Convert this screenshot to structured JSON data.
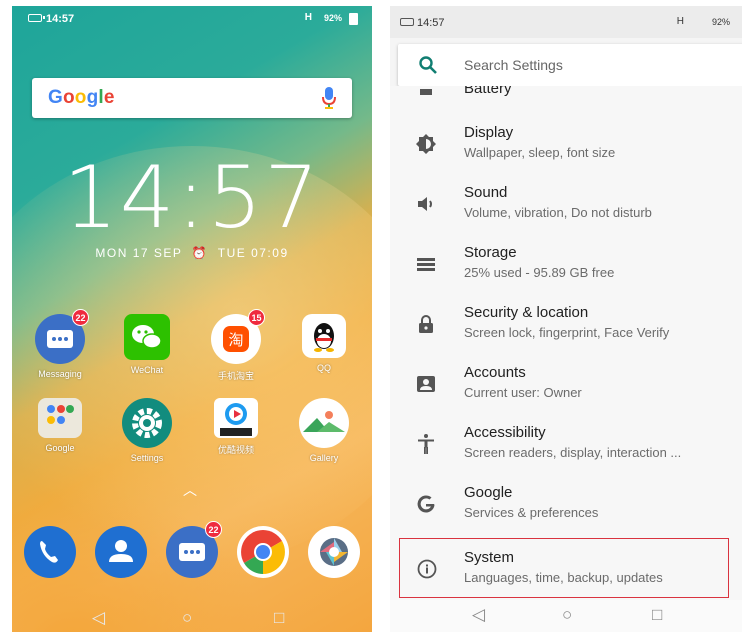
{
  "home": {
    "status": {
      "time": "14:57",
      "network": "H",
      "signal": "92%"
    },
    "search_logo": "Google",
    "clock": "14:57",
    "date_left": "MON 17 SEP",
    "alarm": "TUE 07:09",
    "apps_row1": [
      {
        "label": "Messaging",
        "icon": "message-icon",
        "badge": "22"
      },
      {
        "label": "WeChat",
        "icon": "wechat-icon",
        "badge": ""
      },
      {
        "label": "手机淘宝",
        "icon": "taobao-icon",
        "badge": "15"
      },
      {
        "label": "QQ",
        "icon": "qq-icon",
        "badge": ""
      }
    ],
    "apps_row2": [
      {
        "label": "Google",
        "icon": "google-folder-icon"
      },
      {
        "label": "Settings",
        "icon": "settings-icon"
      },
      {
        "label": "优酷视频",
        "icon": "youku-icon"
      },
      {
        "label": "Gallery",
        "icon": "gallery-icon"
      }
    ],
    "dock": [
      {
        "icon": "phone-icon"
      },
      {
        "icon": "contacts-icon"
      },
      {
        "icon": "message-icon",
        "badge": "22"
      },
      {
        "icon": "chrome-icon"
      },
      {
        "icon": "camera-icon"
      }
    ],
    "nav": {
      "back": "◁",
      "home": "○",
      "recents": "□"
    }
  },
  "settings": {
    "status": {
      "time": "14:57",
      "network": "H",
      "signal": "92%"
    },
    "search_placeholder": "Search Settings",
    "partial_item": "Battery",
    "items": [
      {
        "title": "Display",
        "subtitle": "Wallpaper, sleep, font size",
        "icon": "display-icon"
      },
      {
        "title": "Sound",
        "subtitle": "Volume, vibration, Do not disturb",
        "icon": "sound-icon"
      },
      {
        "title": "Storage",
        "subtitle": "25% used - 95.89 GB free",
        "icon": "storage-icon"
      },
      {
        "title": "Security & location",
        "subtitle": "Screen lock, fingerprint, Face Verify",
        "icon": "lock-icon"
      },
      {
        "title": "Accounts",
        "subtitle": "Current user: Owner",
        "icon": "accounts-icon"
      },
      {
        "title": "Accessibility",
        "subtitle": "Screen readers, display, interaction ...",
        "icon": "accessibility-icon"
      },
      {
        "title": "Google",
        "subtitle": "Services & preferences",
        "icon": "google-g-icon"
      },
      {
        "title": "System",
        "subtitle": "Languages, time, backup, updates",
        "icon": "info-icon"
      }
    ],
    "nav": {
      "back": "◁",
      "home": "○",
      "recents": "□"
    },
    "highlight_color": "#d9333f"
  }
}
